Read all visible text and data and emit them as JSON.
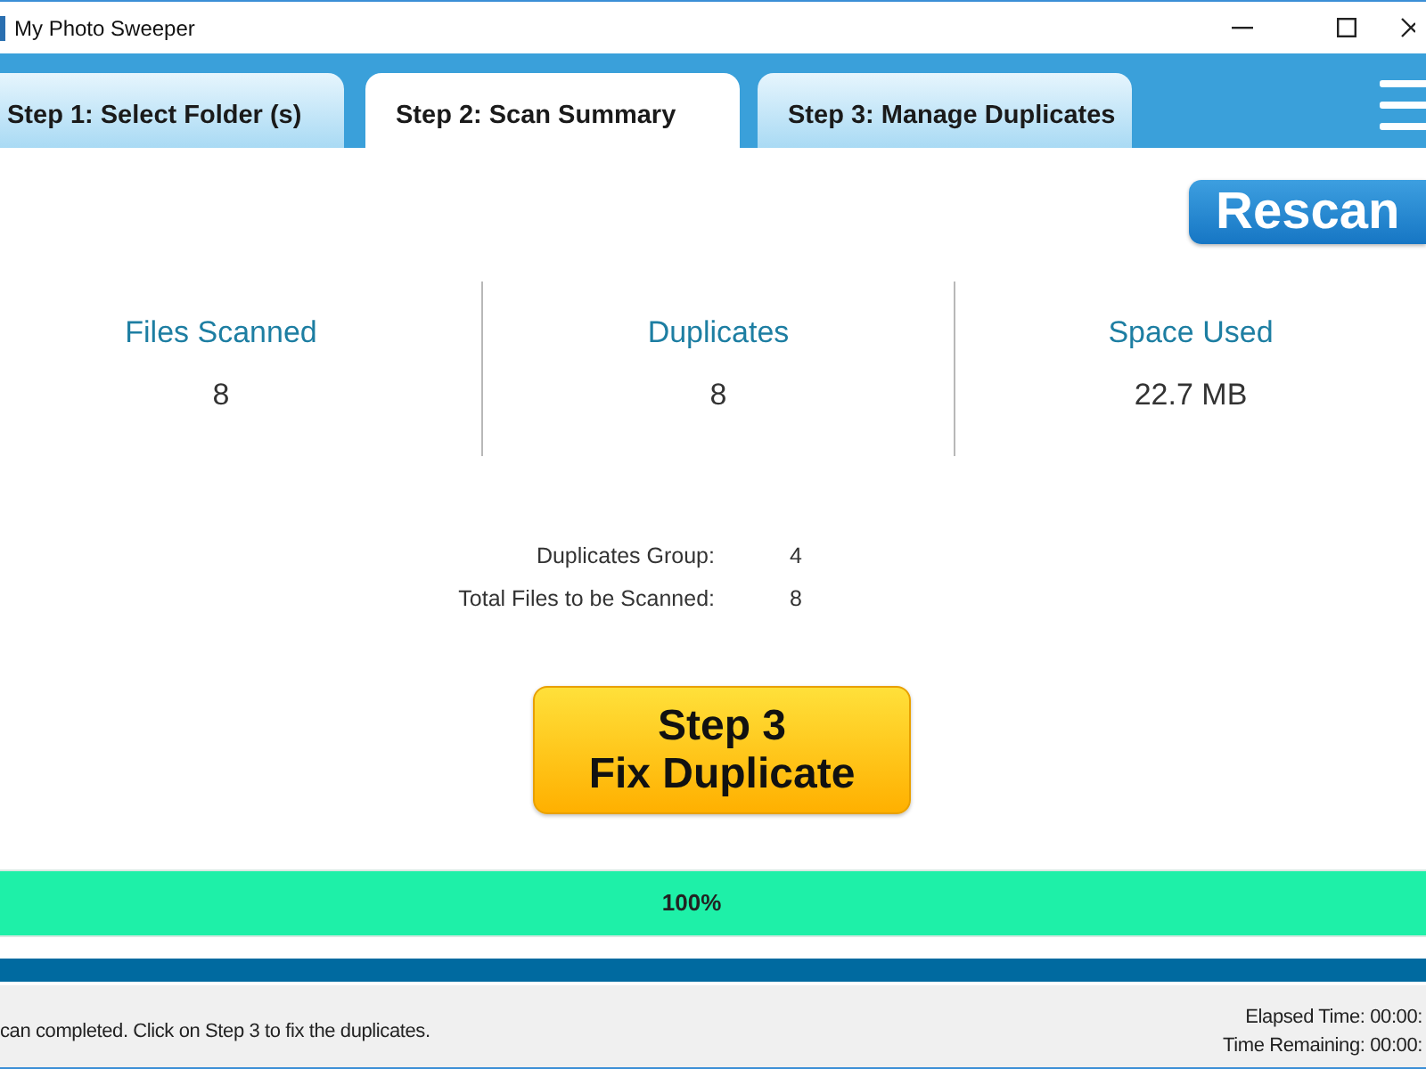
{
  "window": {
    "title": "My Photo Sweeper"
  },
  "tabs": [
    {
      "label": "Step 1: Select Folder (s)",
      "selected": false
    },
    {
      "label": "Step 2: Scan Summary",
      "selected": true
    },
    {
      "label": "Step 3: Manage Duplicates",
      "selected": false
    }
  ],
  "rescan_button": {
    "label": "Rescan"
  },
  "stats": [
    {
      "label": "Files Scanned",
      "value": "8"
    },
    {
      "label": "Duplicates",
      "value": "8"
    },
    {
      "label": "Space Used",
      "value": "22.7 MB"
    }
  ],
  "details": [
    {
      "label": "Duplicates Group:",
      "value": "4"
    },
    {
      "label": "Total Files to be Scanned:",
      "value": "8"
    }
  ],
  "fix_button": {
    "lines": [
      "Step 3",
      "Fix Duplicate"
    ]
  },
  "progress": {
    "level": 1,
    "reading": "100%"
  },
  "status_bar": {
    "message": "can completed. Click on Step 3 to fix the duplicates.",
    "times": [
      "Elapsed Time: 00:00:",
      "Time Remaining: 00:00:"
    ]
  }
}
